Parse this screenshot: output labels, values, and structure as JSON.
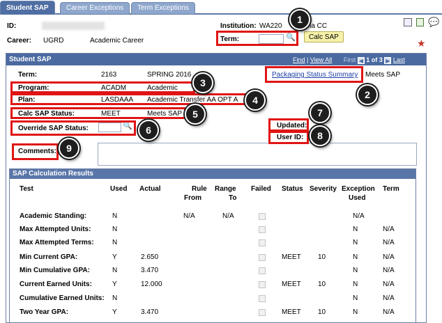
{
  "tabs": [
    {
      "label": "Student SAP",
      "active": true
    },
    {
      "label": "Career Exceptions",
      "active": false
    },
    {
      "label": "Term Exceptions",
      "active": false
    }
  ],
  "header": {
    "id_label": "ID:",
    "institution_label": "Institution:",
    "institution_value": "WA220",
    "institution_name_tail": "ma CC",
    "career_label": "Career:",
    "career_code": "UGRD",
    "career_desc": "Academic Career",
    "term_label": "Term:",
    "calc_sap_button": "Calc SAP"
  },
  "panel": {
    "title": "Student SAP",
    "find": "Find",
    "view_all": "View All",
    "first": "First",
    "count": "1 of 3",
    "last": "Last",
    "term_label": "Term:",
    "term_code": "2163",
    "term_desc": "SPRING 2016",
    "packaging_link": "Packaging Status Summary",
    "packaging_status": "Meets SAP",
    "program_label": "Program:",
    "program_code": "ACADM",
    "program_desc": "Academic",
    "plan_label": "Plan:",
    "plan_code": "LASDAAA",
    "plan_desc": "Academic Transfer AA OPT A",
    "calc_status_label": "Calc SAP Status:",
    "calc_status_code": "MEET",
    "calc_status_desc": "Meets SAP",
    "override_label": "Override SAP Status:",
    "updated_label": "Updated:",
    "userid_label": "User ID:",
    "comments_label": "Comments:"
  },
  "results": {
    "title": "SAP Calculation Results",
    "columns": {
      "test": "Test",
      "used": "Used",
      "actual": "Actual",
      "rule_from_1": "Rule",
      "rule_from_2": "From",
      "range_to_1": "Range",
      "range_to_2": "To",
      "failed": "Failed",
      "status": "Status",
      "severity": "Severity",
      "exception_1": "Exception",
      "exception_2": "Used",
      "term": "Term"
    },
    "rows": [
      {
        "test": "Academic Standing:",
        "used": "N",
        "actual": "",
        "rule_from": "N/A",
        "range_to": "N/A",
        "status": "",
        "severity": "",
        "exception": "N/A",
        "term": ""
      },
      {
        "test": "Max Attempted Units:",
        "used": "N",
        "actual": "",
        "rule_from": "",
        "range_to": "",
        "status": "",
        "severity": "",
        "exception": "N",
        "term": "N/A"
      },
      {
        "test": "Max Attempted Terms:",
        "used": "N",
        "actual": "",
        "rule_from": "",
        "range_to": "",
        "status": "",
        "severity": "",
        "exception": "N",
        "term": "N/A"
      },
      {
        "test": "Min Current GPA:",
        "used": "Y",
        "actual": "2.650",
        "rule_from": "",
        "range_to": "",
        "status": "MEET",
        "severity": "10",
        "exception": "N",
        "term": "N/A"
      },
      {
        "test": "Min Cumulative GPA:",
        "used": "N",
        "actual": "3.470",
        "rule_from": "",
        "range_to": "",
        "status": "",
        "severity": "",
        "exception": "N",
        "term": "N/A"
      },
      {
        "test": "Current Earned Units:",
        "used": "Y",
        "actual": "12.000",
        "rule_from": "",
        "range_to": "",
        "status": "MEET",
        "severity": "10",
        "exception": "N",
        "term": "N/A"
      },
      {
        "test": "Cumulative Earned Units:",
        "used": "N",
        "actual": "",
        "rule_from": "",
        "range_to": "",
        "status": "",
        "severity": "",
        "exception": "N",
        "term": "N/A"
      },
      {
        "test": "Two Year GPA:",
        "used": "Y",
        "actual": "3.470",
        "rule_from": "",
        "range_to": "",
        "status": "MEET",
        "severity": "10",
        "exception": "N",
        "term": "N/A"
      }
    ]
  },
  "callouts": [
    "1",
    "2",
    "3",
    "4",
    "5",
    "6",
    "7",
    "8",
    "9"
  ],
  "colors": {
    "header_bar": "#4b6aa0",
    "highlight_box": "#e01414",
    "badge": "#1e1e1e",
    "button": "#f7f2a9"
  }
}
